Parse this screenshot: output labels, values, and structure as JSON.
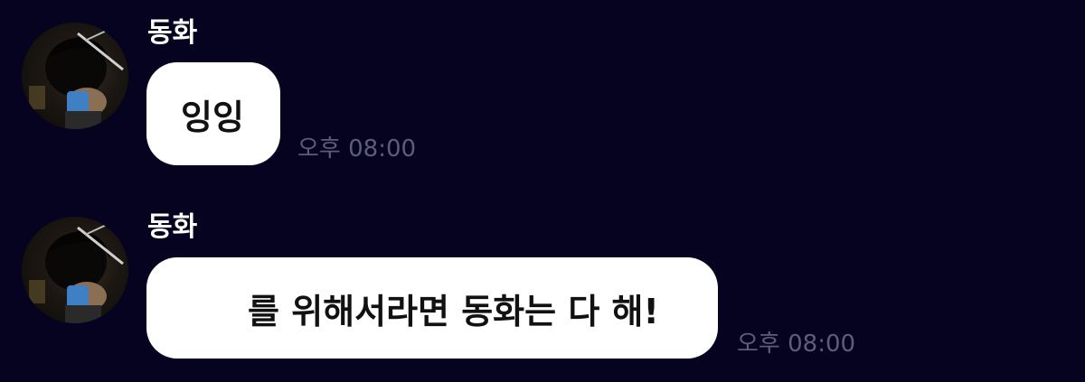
{
  "chat": {
    "background_color": "#05031f",
    "messages": [
      {
        "sender": "동화",
        "avatar_icon": "profile-photo-icon",
        "text": "잉잉",
        "time": "오후 08:00"
      },
      {
        "sender": "동화",
        "avatar_icon": "profile-photo-icon",
        "text": "를 위해서라면 동화는 다 해!",
        "time": "오후 08:00"
      }
    ]
  }
}
